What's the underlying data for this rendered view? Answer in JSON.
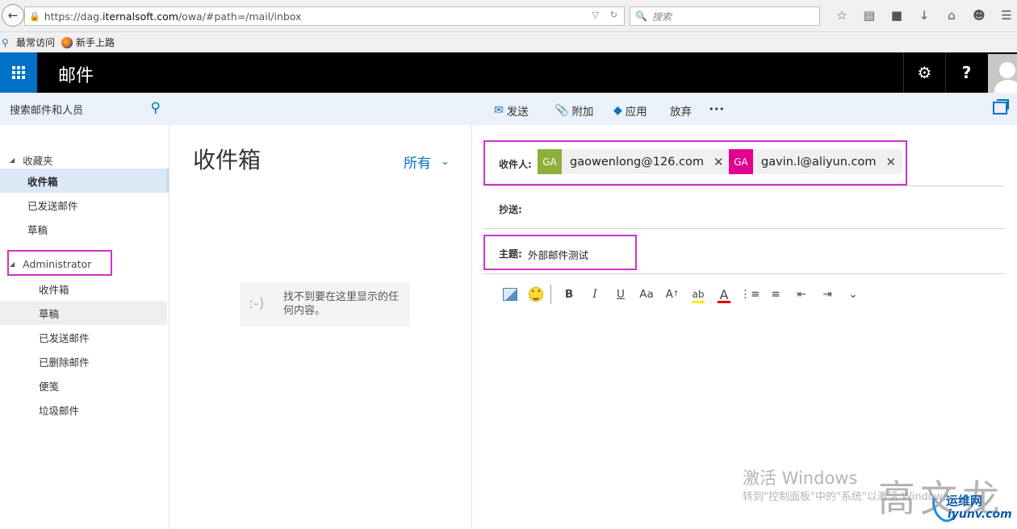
{
  "browser": {
    "url_prefix": "https://dag.",
    "url_host": "iternalsoft.com",
    "url_path": "/owa/#path=/mail/inbox",
    "search_placeholder": "搜索",
    "bookmarks": [
      "最常访问",
      "新手上路"
    ]
  },
  "app": {
    "title": "邮件",
    "settings_icon": "⚙",
    "help_label": "?"
  },
  "search": {
    "placeholder": "搜索邮件和人员"
  },
  "toolbar": {
    "send": "发送",
    "attach": "附加",
    "apps": "应用",
    "discard": "放弃",
    "more": "•••"
  },
  "nav": {
    "favorites_label": "收藏夹",
    "favorites": [
      "收件箱",
      "已发送邮件",
      "草稿"
    ],
    "account_label": "Administrator",
    "folders": [
      "收件箱",
      "草稿",
      "已发送邮件",
      "已删除邮件",
      "便笺",
      "垃圾邮件"
    ]
  },
  "message_list": {
    "folder_title": "收件箱",
    "filter_label": "所有",
    "empty_face": ":-)",
    "empty_text": "找不到要在这里显示的任何内容。"
  },
  "compose": {
    "to_label": "收件人:",
    "recipients": [
      {
        "initials": "GA",
        "email": "gaowenlong@126.com",
        "color": "#8db03c"
      },
      {
        "initials": "GA",
        "email": "gavin.l@aliyun.com",
        "color": "#e3008c"
      }
    ],
    "cc_label": "抄送:",
    "subject_label": "主题:",
    "subject_value": "外部邮件测试",
    "format_buttons": {
      "bold": "B",
      "italic": "I",
      "underline": "U",
      "font_size": "Aa",
      "grow_font": "A",
      "highlight": "ab",
      "font_color": "A"
    }
  },
  "watermark": {
    "title": "激活 Windows",
    "subtitle": "转到\"控制面板\"中的\"系统\"以激活 Windows。",
    "author": "高文龙",
    "site_cn": "运维网",
    "site_en": "iyunv.com"
  },
  "colors": {
    "accent": "#0072c6",
    "header_bg": "#000000",
    "highlight_box": "#cc33cc"
  }
}
